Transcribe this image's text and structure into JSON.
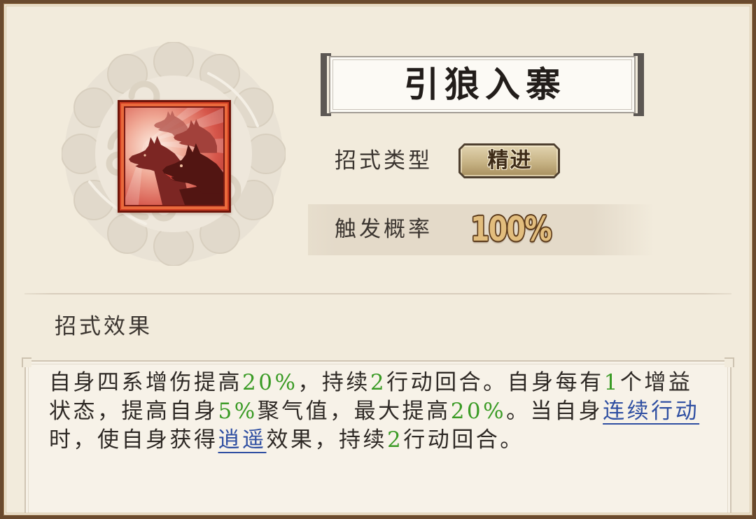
{
  "skill": {
    "name": "引狼入寨"
  },
  "attributes": {
    "type": {
      "label": "招式类型",
      "value": "精进"
    },
    "trigger_chance": {
      "label": "触发概率",
      "value": "100%"
    }
  },
  "effect": {
    "heading": "招式效果",
    "lines": [
      [
        "自身四系增伤提高",
        "20%",
        "，持续",
        "2",
        "行动回合。自身每有",
        "1",
        "个增益"
      ],
      [
        "状态，提高自身",
        "5%",
        "聚气值，最大提高",
        "20%",
        "。当自身",
        "连续行动"
      ],
      [
        "时，使自身获得",
        "逍遥",
        "效果，持续",
        "2",
        "行动回合。"
      ]
    ]
  },
  "icons": {
    "skill": "wolf-pack-icon",
    "emblem": "cloud-emblem-icon"
  },
  "colors": {
    "background": "#f2ebdc",
    "frame": "#6a4a2e",
    "text": "#2e2925",
    "value_highlight": "#3a9b25",
    "keyword_link": "#2f4fa2",
    "chance_value": "#e2bd7d",
    "badge": "#c7b385"
  }
}
